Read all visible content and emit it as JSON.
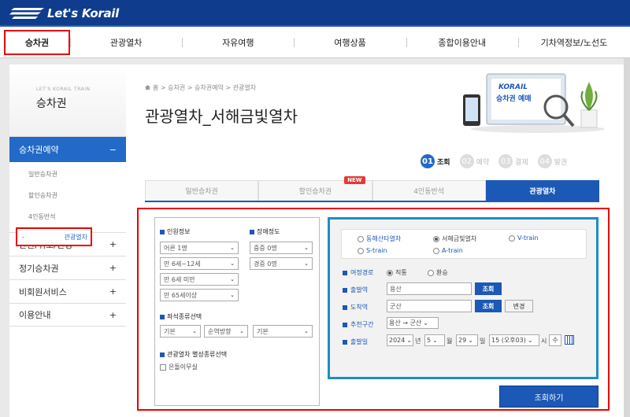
{
  "header": {
    "logo_text": "Let's Korail",
    "nav": [
      "승차권",
      "관광열차",
      "자유여행",
      "여행상품",
      "종합이용안내",
      "기차역정보/노선도"
    ]
  },
  "sidebar": {
    "small_title": "LET'S KORAIL TRAIN",
    "title": "승차권",
    "active_menu": "승차권예약",
    "active_symbol": "−",
    "sub_items": [
      "일반승차권",
      "할인승차권",
      "4인동반석",
      "관광열차"
    ],
    "menus": [
      "반환/취소/변경",
      "정기승차권",
      "비회원서비스",
      "이용안내"
    ],
    "plus": "+"
  },
  "main": {
    "breadcrumb": "홈 > 승차권 > 승차권예약 > 관광열차",
    "home_icon": "house-icon",
    "title": "관광열차_서해금빛열차",
    "hero": {
      "brand": "KORAIL",
      "caption": "승차권 예매"
    },
    "steps": [
      {
        "num": "01",
        "label": "조회"
      },
      {
        "num": "02",
        "label": "예약"
      },
      {
        "num": "03",
        "label": "결제"
      },
      {
        "num": "04",
        "label": "발권"
      }
    ],
    "tabs": [
      "일반승차권",
      "할인승차권",
      "4인동반석",
      "관광열차"
    ],
    "new_badge": "NEW"
  },
  "form_left": {
    "passenger_title": "인원정보",
    "disability_title": "장애정도",
    "passenger_selects": [
      "어른 1명",
      "만 6세~12세",
      "만 6세 미만",
      "만 65세이상"
    ],
    "disability_selects": [
      "중증 0명",
      "경증 0명"
    ],
    "seat_title": "좌석종류선택",
    "seat_selects": [
      "기본",
      "순역방향",
      "기본"
    ],
    "tour_title": "관광열차 별성종류선택",
    "checkbox_label": "은돌이무실"
  },
  "form_right": {
    "trains": [
      {
        "label": "동해산타열차",
        "checked": false
      },
      {
        "label": "서해금빛열차",
        "checked": true
      },
      {
        "label": "V-train",
        "checked": false
      },
      {
        "label": "S-train",
        "checked": false
      },
      {
        "label": "A-train",
        "checked": false
      }
    ],
    "route_label": "여정경로",
    "route_options": [
      {
        "label": "직통",
        "checked": true
      },
      {
        "label": "환승",
        "checked": false
      }
    ],
    "departure_label": "출발역",
    "departure_value": "용산",
    "arrival_label": "도착역",
    "arrival_value": "군산",
    "search_btn": "조회",
    "swap_btn": "변경",
    "recommend_label": "추천구간",
    "recommend_value": "용산 → 군산",
    "date_label": "출발일",
    "date": {
      "year": "2024",
      "year_unit": "년",
      "month": "5",
      "month_unit": "월",
      "day": "29",
      "day_unit": "일",
      "hour": "15 (오후03)",
      "hour_unit": "시",
      "extra": "수"
    },
    "calendar_icon": "calendar-icon"
  },
  "submit_label": "조회하기"
}
